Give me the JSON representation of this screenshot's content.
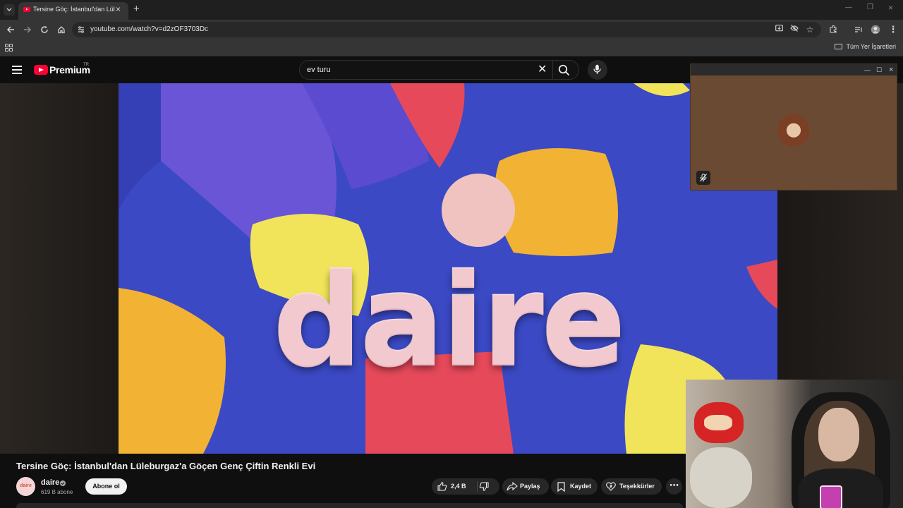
{
  "browser": {
    "tab_title": "Tersine Göç: İstanbul'dan Lüleburgaz'a Göçen Genç Çiftin Renkli Evi",
    "url": "youtube.com/watch?v=d2zOF3703Dc",
    "bookmarks_all": "Tüm Yer İşaretleri"
  },
  "youtube": {
    "logo_text": "Premium",
    "region": "TR",
    "search_query": "ev turu"
  },
  "video": {
    "thumbnail_text": "daire",
    "title": "Tersine Göç: İstanbul'dan Lüleburgaz'a Göçen Genç Çiftin Renkli Evi",
    "channel": {
      "avatar_text": "daire",
      "name": "daire",
      "subscribers": "619 B abone",
      "subscribe_label": "Abone ol"
    },
    "actions": {
      "like_count": "2,4 B",
      "share_label": "Paylaş",
      "save_label": "Kaydet",
      "thanks_label": "Teşekkürler",
      "more_label": "⋯"
    }
  },
  "colors": {
    "youtube_red": "#ff0033",
    "background": "#0f0f0f",
    "pill": "#272727",
    "thumb_blue": "#3b49c4",
    "thumb_purple": "#6a55d6",
    "thumb_yellow": "#f2b234",
    "thumb_red": "#e6495a",
    "thumb_letters": "#f1c9cf"
  },
  "icons": [
    "tab-search-icon",
    "youtube-favicon-icon",
    "close-icon",
    "new-tab-icon",
    "back-icon",
    "forward-icon",
    "reload-icon",
    "home-icon",
    "site-info-icon",
    "install-app-icon",
    "eye-off-icon",
    "star-icon",
    "extensions-icon",
    "media-control-icon",
    "profile-icon",
    "kebab-menu-icon",
    "apps-grid-icon",
    "folder-icon",
    "hamburger-icon",
    "youtube-logo-icon",
    "search-icon",
    "mic-icon",
    "verified-icon",
    "thumbs-up-icon",
    "thumbs-down-icon",
    "share-icon",
    "bookmark-icon",
    "thanks-icon",
    "mute-icon"
  ]
}
